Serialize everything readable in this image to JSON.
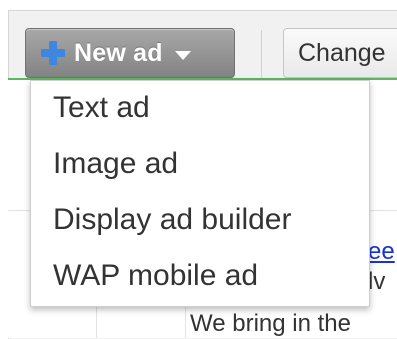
{
  "toolbar": {
    "new_ad_label": "New ad",
    "change_label": "Change"
  },
  "menu": {
    "items": [
      {
        "label": "Text ad"
      },
      {
        "label": "Image ad"
      },
      {
        "label": "Display ad builder"
      },
      {
        "label": "WAP mobile ad"
      }
    ]
  },
  "background_content": {
    "link_fragment": "ee",
    "text_fragment": "lv",
    "body_fragment": "We bring in the"
  },
  "colors": {
    "button_primary": "#949494",
    "plus_icon": "#3f86e0",
    "accent_line": "#5cb85c",
    "link": "#1a33cc"
  },
  "icons": {
    "new_ad": "plus-icon",
    "dropdown": "chevron-down-icon"
  }
}
